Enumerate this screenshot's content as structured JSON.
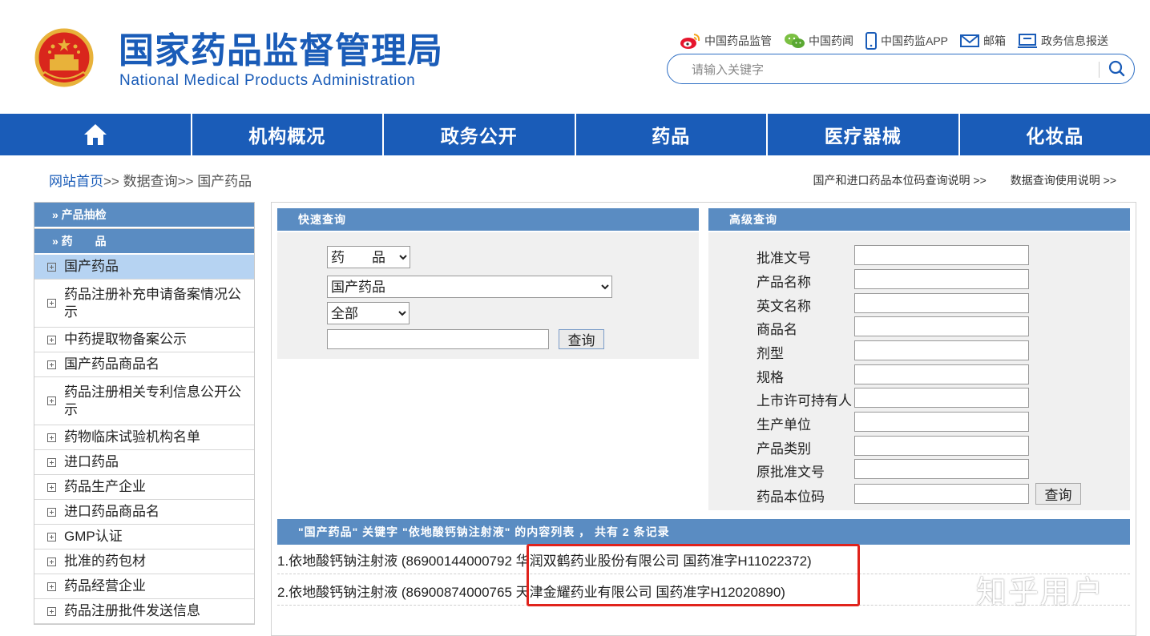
{
  "header": {
    "title_cn": "国家药品监督管理局",
    "title_en": "National Medical Products Administration",
    "top_links": [
      {
        "icon": "weibo-icon",
        "label": "中国药品监管"
      },
      {
        "icon": "wechat-icon",
        "label": "中国药闻"
      },
      {
        "icon": "mobile-icon",
        "label": "中国药监APP"
      },
      {
        "icon": "mail-icon",
        "label": "邮箱"
      },
      {
        "icon": "monitor-icon",
        "label": "政务信息报送"
      }
    ],
    "search_placeholder": "请输入关键字"
  },
  "nav": {
    "home_icon": "home-icon",
    "items": [
      "机构概况",
      "政务公开",
      "药品",
      "医疗器械",
      "化妆品"
    ]
  },
  "breadcrumb": {
    "home": "网站首页",
    "sep": ">>",
    "level2": "数据查询",
    "level3": "国产药品"
  },
  "help_links": [
    "国产和进口药品本位码查询说明 >>",
    "数据查询使用说明 >>"
  ],
  "sidebar": {
    "sections": [
      "» 产品抽检",
      "» 药　　品"
    ],
    "items": [
      "国产药品",
      "药品注册补充申请备案情况公示",
      "中药提取物备案公示",
      "国产药品商品名",
      "药品注册相关专利信息公开公示",
      "药物临床试验机构名单",
      "进口药品",
      "药品生产企业",
      "进口药品商品名",
      "GMP认证",
      "批准的药包材",
      "药品经营企业",
      "药品注册批件发送信息"
    ],
    "active_index": 0
  },
  "quick_search": {
    "title": "快速查询",
    "select1": "药　　品",
    "select2": "国产药品",
    "select3": "全部",
    "input_value": "",
    "button": "查询"
  },
  "advanced_search": {
    "title": "高级查询",
    "fields": [
      "批准文号",
      "产品名称",
      "英文名称",
      "商品名",
      "剂型",
      "规格",
      "上市许可持有人",
      "生产单位",
      "产品类别",
      "原批准文号",
      "药品本位码"
    ],
    "button": "查询"
  },
  "results": {
    "header": "\"国产药品\" 关键字 \"依地酸钙钠注射液\" 的内容列表 ， 共有 2 条记录",
    "rows": [
      "1.依地酸钙钠注射液 (86900144000792 华润双鹤药业股份有限公司 国药准字H11022372)",
      "2.依地酸钙钠注射液 (86900874000765 天津金耀药业有限公司 国药准字H12020890)"
    ]
  },
  "watermark": "知乎用户",
  "colors": {
    "brand_blue": "#1a5cb8",
    "panel_blue": "#5a8cc2",
    "active_item": "#b6d3f2",
    "highlight_red": "#e0231c"
  }
}
